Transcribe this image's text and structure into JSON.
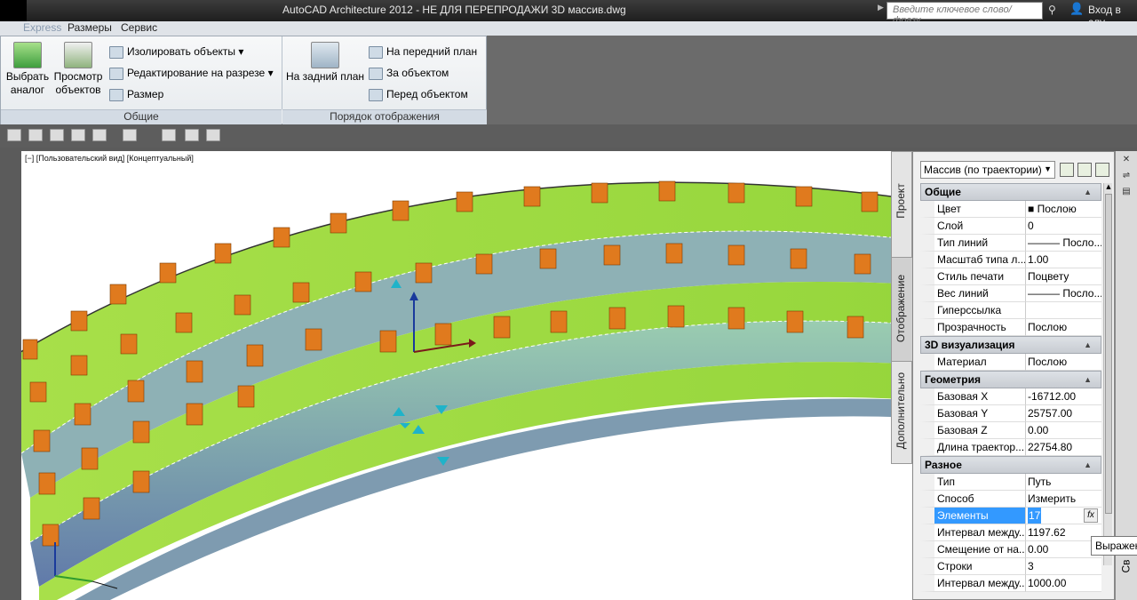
{
  "titlebar": {
    "title": "AutoCAD Architecture 2012 - НЕ ДЛЯ ПЕРЕПРОДАЖИ    3D массив.dwg",
    "search_placeholder": "Введите ключевое слово/фразу",
    "login": "Вход в слу"
  },
  "menubar": {
    "items": [
      "Express",
      "Размеры",
      "Сервис"
    ]
  },
  "ribbon": {
    "panel_general": {
      "title": "Общие",
      "select_similar": "Выбрать аналог",
      "view_objects": "Просмотр объектов",
      "isolate": "Изолировать объекты",
      "edit_section": "Редактирование на разрезе",
      "dimension": "Размер"
    },
    "panel_order": {
      "title": "Порядок отображения",
      "send_back": "На задний план",
      "bring_front": "На передний план",
      "behind": "За объектом",
      "in_front": "Перед объектом"
    }
  },
  "viewport": {
    "label": "[−] [Пользовательский вид] [Концептуальный]"
  },
  "palette": {
    "object_type": "Массив (по траектории)",
    "tabs": [
      "Проект",
      "Отображение",
      "Дополнительно"
    ],
    "sections": [
      {
        "title": "Общие",
        "rows": [
          {
            "name": "Цвет",
            "value": "■ Послою"
          },
          {
            "name": "Слой",
            "value": "0"
          },
          {
            "name": "Тип линий",
            "value": "——— Посло..."
          },
          {
            "name": "Масштаб типа л...",
            "value": "1.00"
          },
          {
            "name": "Стиль печати",
            "value": "Поцвету"
          },
          {
            "name": "Вес линий",
            "value": "——— Посло..."
          },
          {
            "name": "Гиперссылка",
            "value": ""
          },
          {
            "name": "Прозрачность",
            "value": "Послою"
          }
        ]
      },
      {
        "title": "3D визуализация",
        "rows": [
          {
            "name": "Материал",
            "value": "Послою"
          }
        ]
      },
      {
        "title": "Геометрия",
        "rows": [
          {
            "name": "Базовая X",
            "value": "-16712.00"
          },
          {
            "name": "Базовая Y",
            "value": "25757.00"
          },
          {
            "name": "Базовая Z",
            "value": "0.00"
          },
          {
            "name": "Длина траектор...",
            "value": "22754.80"
          }
        ]
      },
      {
        "title": "Разное",
        "rows": [
          {
            "name": "Тип",
            "value": "Путь"
          },
          {
            "name": "Способ",
            "value": "Измерить"
          },
          {
            "name": "Элементы",
            "value": "17"
          },
          {
            "name": "Интервал между...",
            "value": "1197.62"
          },
          {
            "name": "Смещение от на...",
            "value": "0.00"
          },
          {
            "name": "Строки",
            "value": "3"
          },
          {
            "name": "Интервал между...",
            "value": "1000.00"
          }
        ]
      }
    ],
    "tooltip": "Выражен",
    "right_strip_label": "Св"
  },
  "colors": {
    "accent": "#9ddc3a",
    "selection": "#3399ff",
    "chair": "#e07a1e"
  }
}
